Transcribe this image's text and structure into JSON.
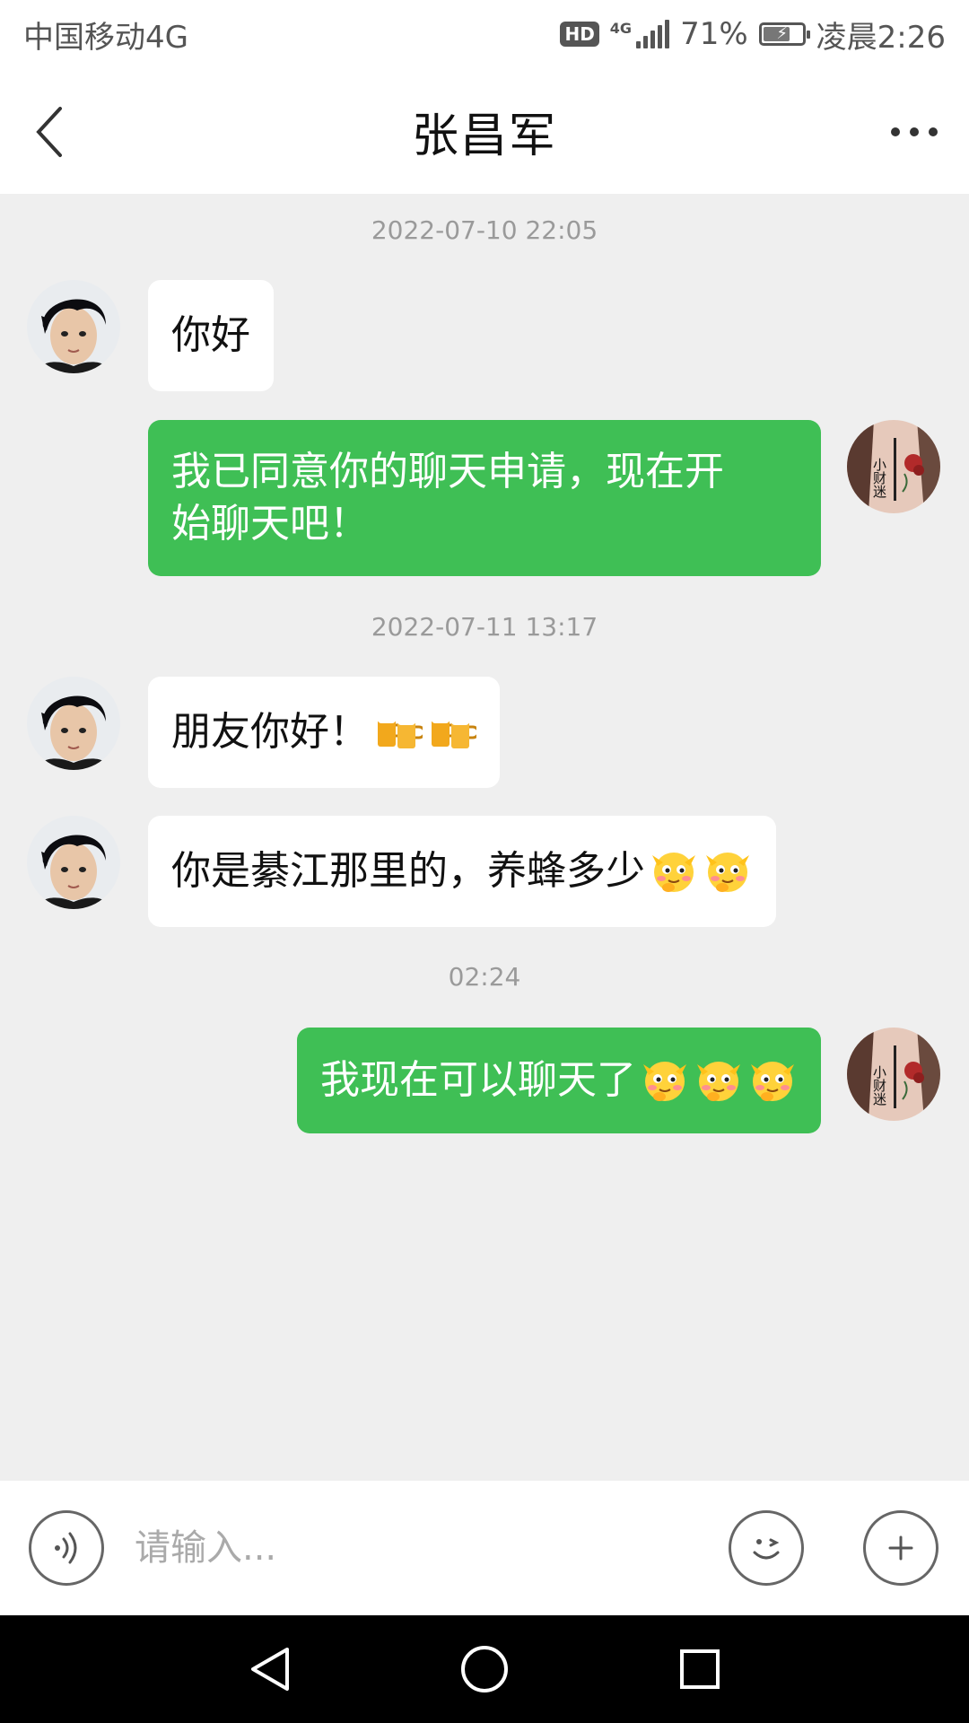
{
  "status_bar": {
    "carrier": "中国移动4G",
    "hd": "HD",
    "network": "4G",
    "battery_percent": "71%",
    "battery_level": 0.71,
    "time": "凌晨2:26"
  },
  "header": {
    "title": "张昌军"
  },
  "chat": {
    "timestamps": [
      "2022-07-10 22:05",
      "2022-07-11 13:17",
      "02:24"
    ],
    "messages": [
      {
        "direction": "in",
        "text": "你好",
        "emojis": []
      },
      {
        "direction": "out",
        "line1": "我已同意你的聊天申请，现在开",
        "line2": "始聊天吧！"
      },
      {
        "direction": "in",
        "text": "朋友你好！",
        "emojis": [
          "beer-mugs-emoji",
          "beer-mugs-emoji"
        ]
      },
      {
        "direction": "in",
        "text": "你是綦江那里的，养蜂多少",
        "emojis": [
          "smirk-emoji",
          "smirk-emoji"
        ]
      },
      {
        "direction": "out",
        "text": "我现在可以聊天了",
        "emojis": [
          "smirk-emoji",
          "smirk-emoji",
          "smirk-emoji"
        ]
      }
    ],
    "self_avatar_text": "小财迷"
  },
  "input_bar": {
    "placeholder": "请输入..."
  },
  "colors": {
    "out_bubble": "#3fbf55",
    "in_bubble": "#ffffff",
    "chat_background": "#efefef"
  },
  "icons": {
    "back": "back-chevron-icon",
    "more": "more-dots-icon",
    "voice": "voice-icon",
    "emoji": "emoji-face-icon",
    "plus": "plus-icon",
    "nav_back": "triangle-back-icon",
    "nav_home": "circle-home-icon",
    "nav_recent": "square-recent-icon"
  }
}
